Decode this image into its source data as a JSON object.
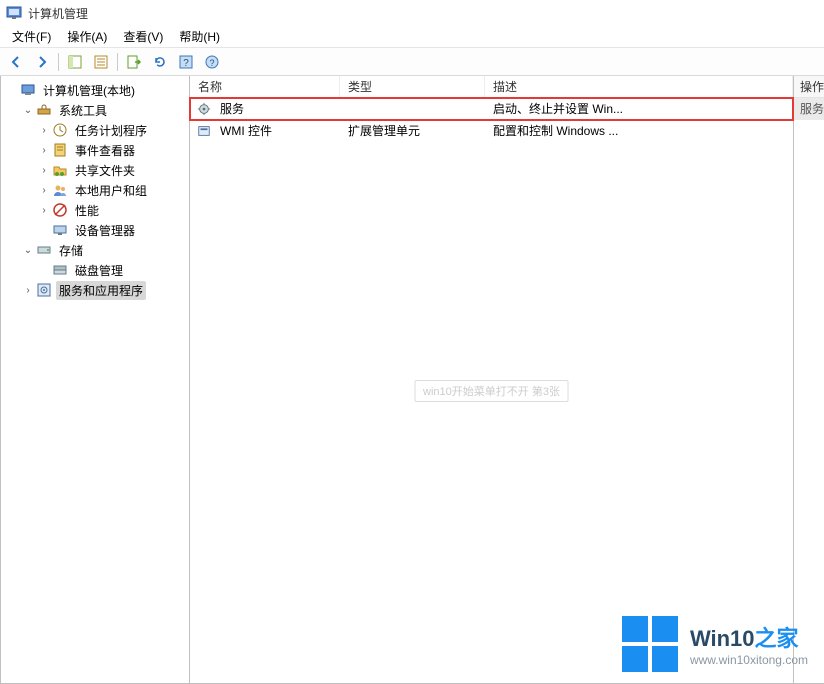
{
  "window": {
    "title": "计算机管理"
  },
  "menus": {
    "file": "文件(F)",
    "action": "操作(A)",
    "view": "查看(V)",
    "help": "帮助(H)"
  },
  "toolbar_icons": [
    "back",
    "forward",
    "show-hide",
    "properties",
    "export",
    "refresh",
    "help-what",
    "help"
  ],
  "tree": {
    "root": {
      "label": "计算机管理(本地)"
    },
    "system_tools": {
      "label": "系统工具",
      "children": {
        "task_scheduler": "任务计划程序",
        "event_viewer": "事件查看器",
        "shared_folders": "共享文件夹",
        "local_users": "本地用户和组",
        "performance": "性能",
        "device_manager": "设备管理器"
      }
    },
    "storage": {
      "label": "存储",
      "disk_mgmt": "磁盘管理"
    },
    "services_apps": {
      "label": "服务和应用程序"
    }
  },
  "columns": {
    "name": "名称",
    "type": "类型",
    "desc": "描述"
  },
  "rows": [
    {
      "name": "服务",
      "type": "",
      "desc": "启动、终止并设置 Win...",
      "highlight": true
    },
    {
      "name": "WMI 控件",
      "type": "扩展管理单元",
      "desc": "配置和控制 Windows ...",
      "highlight": false
    }
  ],
  "actions": {
    "header": "操作",
    "item": "服务"
  },
  "watermark": "win10开始菜单打不开 第3张",
  "brand": {
    "title_pre": "Win10",
    "title_accent": "之家",
    "subtitle": "www.win10xitong.com"
  }
}
